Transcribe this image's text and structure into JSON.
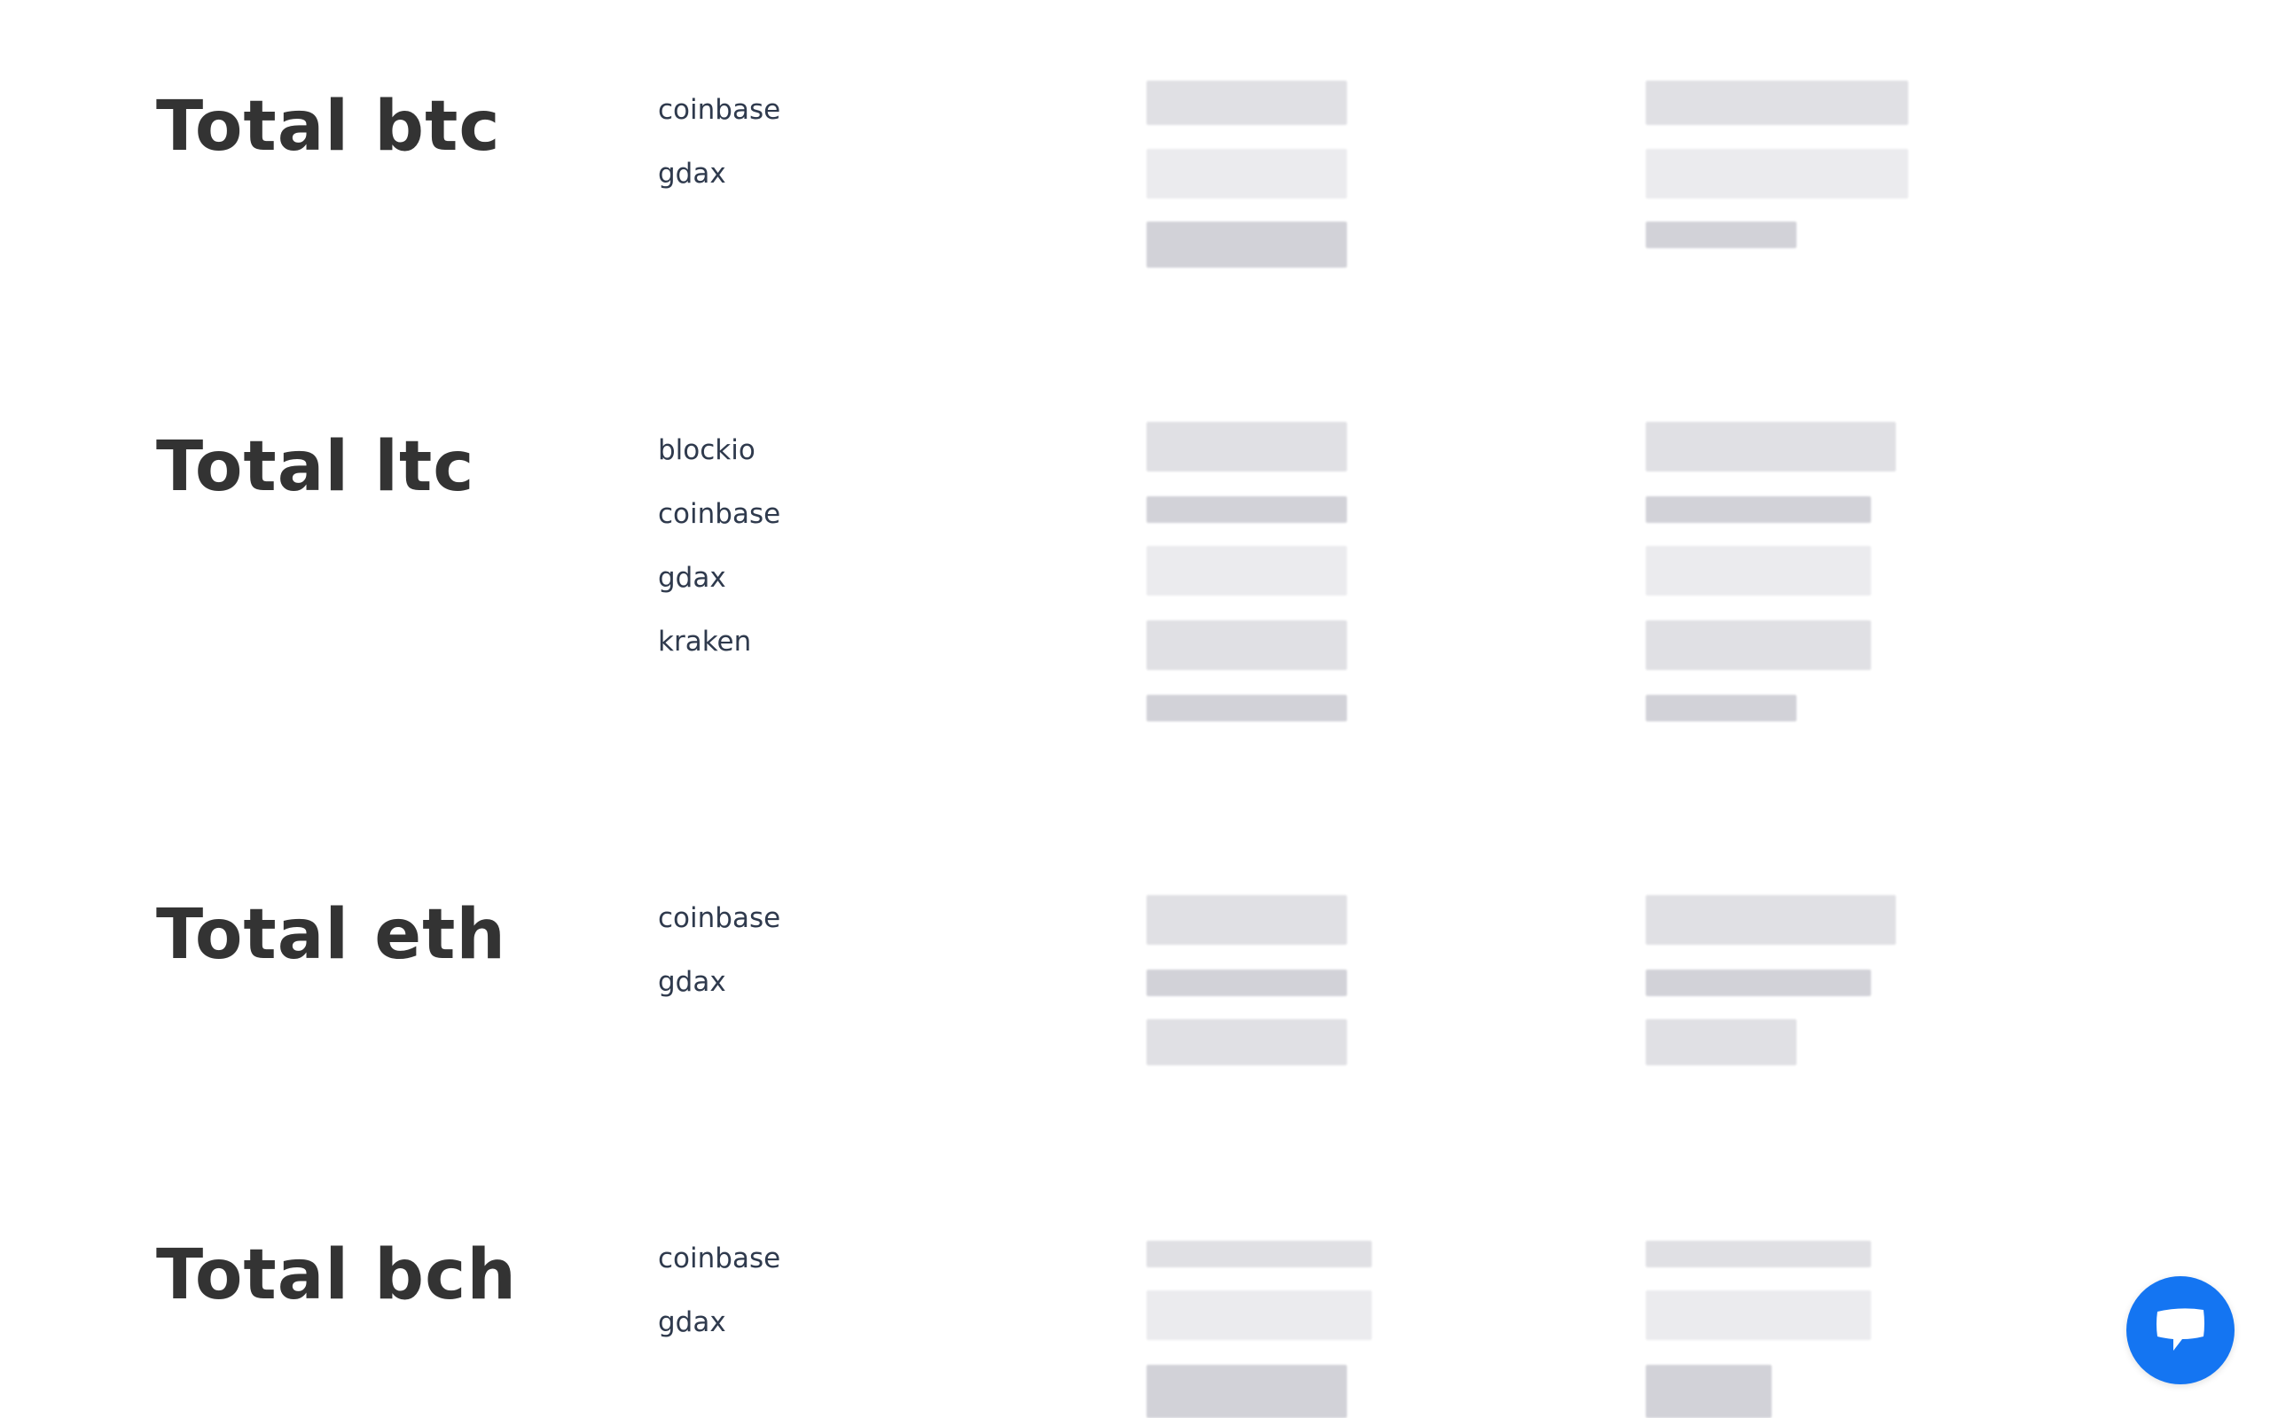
{
  "sections": [
    {
      "title": "Total btc",
      "exchanges": [
        "coinbase",
        "gdax"
      ]
    },
    {
      "title": "Total ltc",
      "exchanges": [
        "blockio",
        "coinbase",
        "gdax",
        "kraken"
      ]
    },
    {
      "title": "Total eth",
      "exchanges": [
        "coinbase",
        "gdax"
      ]
    },
    {
      "title": "Total bch",
      "exchanges": [
        "coinbase",
        "gdax"
      ]
    }
  ],
  "chat": {
    "icon": "chat-bubble-icon",
    "color": "#1475f2"
  },
  "colors": {
    "heading": "#333333",
    "exchange_label": "#2f3a4d",
    "redacted": "#dcdce2"
  }
}
